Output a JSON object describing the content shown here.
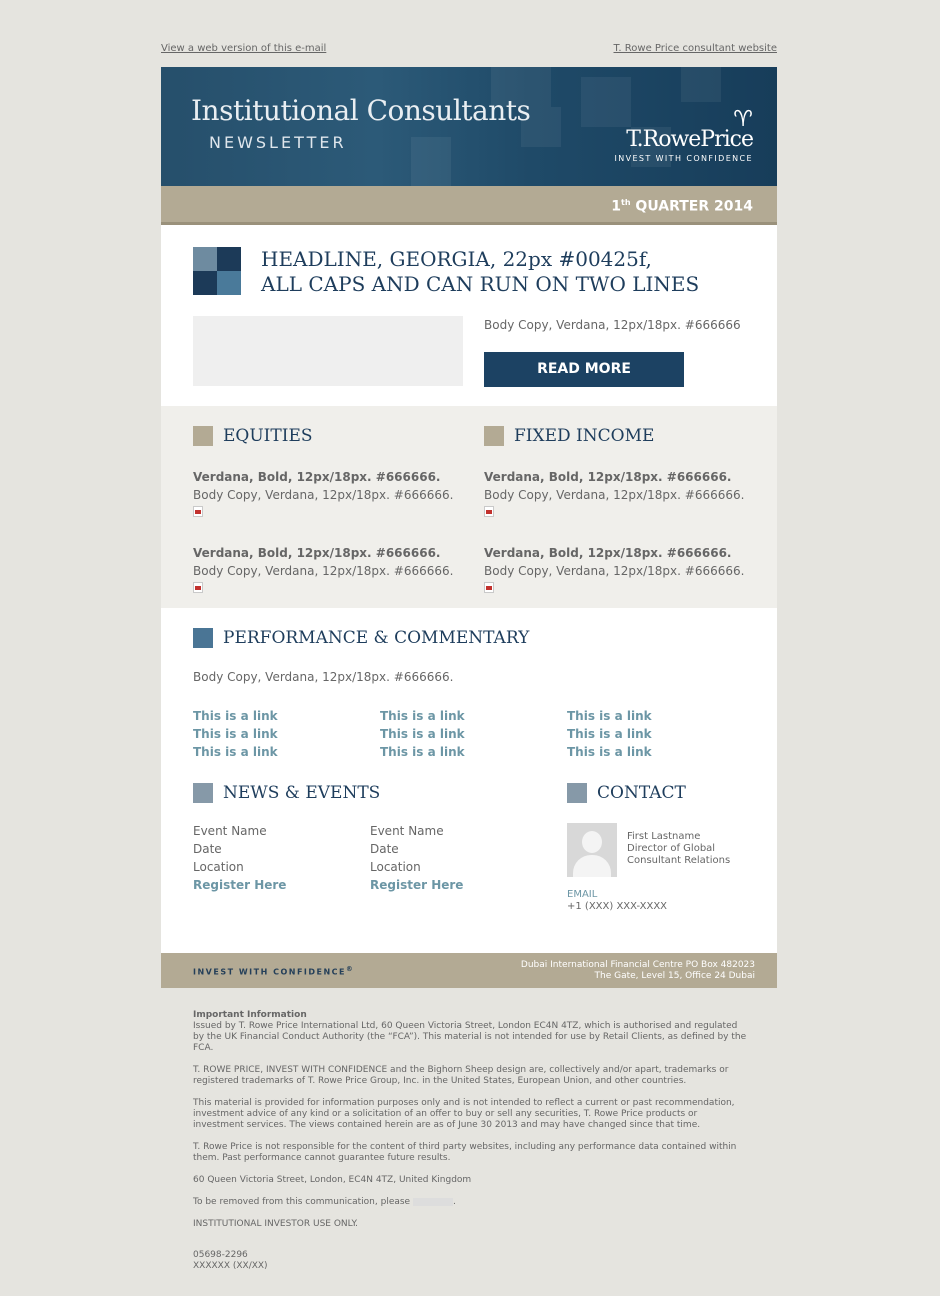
{
  "toplinks": {
    "web_version": "View a web version of this e-mail",
    "consultant_site": "T. Rowe Price consultant website"
  },
  "header": {
    "title": "Institutional Consultants",
    "subtitle": "NEWSLETTER",
    "brand": "T.RowePrice",
    "tagline": "INVEST WITH CONFIDENCE",
    "quarter_num": "1",
    "quarter_sup": "th",
    "quarter_rest": " QUARTER 2014"
  },
  "lead": {
    "headline_line1": "HEADLINE, GEORGIA, 22px #00425f,",
    "headline_line2": "ALL CAPS AND CAN RUN ON TWO LINES",
    "body": "Body Copy, Verdana, 12px/18px. #666666",
    "button": "READ MORE"
  },
  "equities": {
    "title": "EQUITIES",
    "items": [
      {
        "bold": "Verdana, Bold, 12px/18px. #666666.",
        "body": "Body Copy, Verdana, 12px/18px. #666666."
      },
      {
        "bold": "Verdana, Bold, 12px/18px. #666666.",
        "body": "Body Copy, Verdana, 12px/18px. #666666."
      }
    ]
  },
  "fixed_income": {
    "title": "FIXED INCOME",
    "items": [
      {
        "bold": "Verdana, Bold, 12px/18px. #666666.",
        "body": "Body Copy, Verdana, 12px/18px. #666666."
      },
      {
        "bold": "Verdana, Bold, 12px/18px. #666666.",
        "body": "Body Copy, Verdana, 12px/18px. #666666."
      }
    ]
  },
  "performance": {
    "title": "PERFORMANCE & COMMENTARY",
    "body": "Body Copy, Verdana, 12px/18px. #666666.",
    "links": [
      [
        "This is a link",
        "This is a link",
        "This is a link"
      ],
      [
        "This is a link",
        "This is a link",
        "This is a link"
      ],
      [
        "This is a link",
        "This is a link",
        "This is a link"
      ]
    ]
  },
  "news": {
    "title": "NEWS & EVENTS",
    "events": [
      {
        "name": "Event Name",
        "date": "Date",
        "location": "Location",
        "register": "Register Here"
      },
      {
        "name": "Event Name",
        "date": "Date",
        "location": "Location",
        "register": "Register Here"
      }
    ]
  },
  "contact": {
    "title": "CONTACT",
    "name": "First Lastname",
    "role1": "Director of Global",
    "role2": "Consultant Relations",
    "email_label": "EMAIL",
    "phone": "+1 (XXX) XXX-XXXX"
  },
  "footer": {
    "tagline": "INVEST WITH CONFIDENCE",
    "reg": "®",
    "addr1": "Dubai International Financial Centre PO Box 482023",
    "addr2": "The Gate, Level 15, Office 24 Dubai"
  },
  "legal": {
    "heading": "Important Information",
    "p1": "Issued by T. Rowe Price International Ltd, 60 Queen Victoria Street, London EC4N 4TZ, which is authorised and regulated by the UK Financial Conduct Authority (the “FCA”). This material is not intended for use by Retail Clients, as defined by the FCA.",
    "p2": "T. ROWE PRICE, INVEST WITH CONFIDENCE and the Bighorn Sheep design are, collectively and/or apart, trademarks or registered trademarks of T. Rowe Price Group, Inc. in the United States, European Union, and other countries.",
    "p3": "This material is provided for information purposes only and is not intended to reflect a current or past recommendation, investment advice of any kind or a solicitation of an offer to buy or sell any securities, T. Rowe Price products or investment services. The views contained herein are as of June 30 2013 and may have changed since that time.",
    "p4": "T. Rowe Price is not responsible for the content of third party websites, including any performance data contained within them. Past performance cannot guarantee future results.",
    "p5": "60 Queen Victoria Street, London, EC4N 4TZ, United Kingdom",
    "p6": "To be removed from this communication, please",
    "p6_end": ".",
    "p7": "INSTITUTIONAL INVESTOR USE ONLY.",
    "code1": "05698-2296",
    "code2": "XXXXXX (XX/XX)"
  },
  "colors": {
    "navy": "#1e3d5c",
    "band": "#b3aa94",
    "link": "#6c96a5",
    "body": "#666666"
  }
}
